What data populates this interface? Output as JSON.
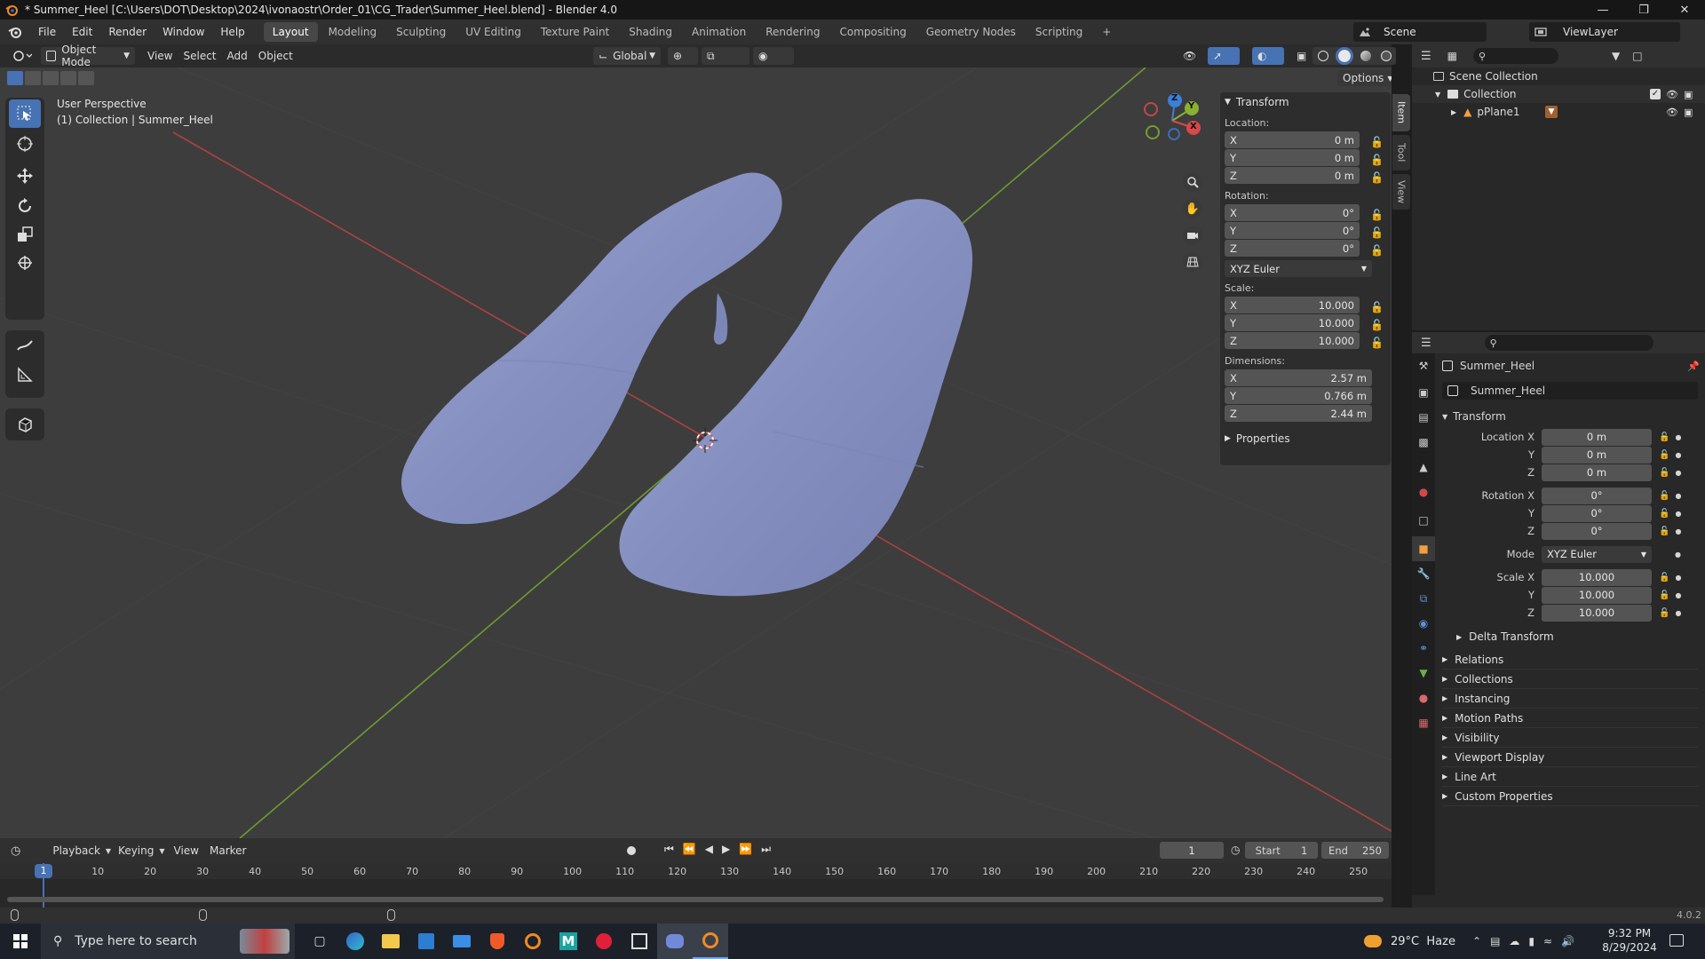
{
  "window": {
    "title": "* Summer_Heel [C:\\Users\\DOT\\Desktop\\2024\\ivonaostr\\Order_01\\CG_Trader\\Summer_Heel.blend] - Blender 4.0"
  },
  "menu": {
    "items": [
      "File",
      "Edit",
      "Render",
      "Window",
      "Help"
    ],
    "workspaces": [
      "Layout",
      "Modeling",
      "Sculpting",
      "UV Editing",
      "Texture Paint",
      "Shading",
      "Animation",
      "Rendering",
      "Compositing",
      "Geometry Nodes",
      "Scripting"
    ],
    "add_tab": "+",
    "scene": "Scene",
    "view_layer": "ViewLayer"
  },
  "viewport_header": {
    "mode": "Object Mode",
    "menus": [
      "View",
      "Select",
      "Add",
      "Object"
    ],
    "orientation": "Global",
    "options": "Options"
  },
  "viewport": {
    "perspective": "User Perspective",
    "collection_info": "(1) Collection | Summer_Heel",
    "gizmo_axes": [
      "Z",
      "Y",
      "X"
    ]
  },
  "npanel": {
    "tabs": [
      "Item",
      "Tool",
      "View"
    ],
    "transform_title": "Transform",
    "location_label": "Location:",
    "location": [
      {
        "axis": "X",
        "value": "0 m"
      },
      {
        "axis": "Y",
        "value": "0 m"
      },
      {
        "axis": "Z",
        "value": "0 m"
      }
    ],
    "rotation_label": "Rotation:",
    "rotation": [
      {
        "axis": "X",
        "value": "0°"
      },
      {
        "axis": "Y",
        "value": "0°"
      },
      {
        "axis": "Z",
        "value": "0°"
      }
    ],
    "rotation_mode": "XYZ Euler",
    "scale_label": "Scale:",
    "scale": [
      {
        "axis": "X",
        "value": "10.000"
      },
      {
        "axis": "Y",
        "value": "10.000"
      },
      {
        "axis": "Z",
        "value": "10.000"
      }
    ],
    "dimensions_label": "Dimensions:",
    "dimensions": [
      {
        "axis": "X",
        "value": "2.57 m"
      },
      {
        "axis": "Y",
        "value": "0.766 m"
      },
      {
        "axis": "Z",
        "value": "2.44 m"
      }
    ],
    "properties_title": "Properties"
  },
  "outliner": {
    "scene_collection": "Scene Collection",
    "collection": "Collection",
    "object": "pPlane1"
  },
  "properties": {
    "object_name": "Summer_Heel",
    "data_name": "Summer_Heel",
    "transform_title": "Transform",
    "location_label": "Location X",
    "location": [
      "0 m",
      "0 m",
      "0 m"
    ],
    "rotation_label": "Rotation X",
    "rotation": [
      "0°",
      "0°",
      "0°"
    ],
    "mode_label": "Mode",
    "mode": "XYZ Euler",
    "scale_label": "Scale X",
    "scale": [
      "10.000",
      "10.000",
      "10.000"
    ],
    "axis_y": "Y",
    "axis_z": "Z",
    "sections": [
      "Delta Transform",
      "Relations",
      "Collections",
      "Instancing",
      "Motion Paths",
      "Visibility",
      "Viewport Display",
      "Line Art",
      "Custom Properties"
    ]
  },
  "timeline": {
    "menus": [
      "Playback",
      "Keying",
      "View",
      "Marker"
    ],
    "current_frame": "1",
    "start_label": "Start",
    "start": "1",
    "end_label": "End",
    "end": "250",
    "ruler": [
      "1",
      "10",
      "20",
      "30",
      "40",
      "50",
      "60",
      "70",
      "80",
      "90",
      "100",
      "110",
      "120",
      "130",
      "140",
      "150",
      "160",
      "170",
      "180",
      "190",
      "200",
      "210",
      "220",
      "230",
      "240",
      "250"
    ]
  },
  "status": {
    "version": "4.0.2"
  },
  "taskbar": {
    "search_placeholder": "Type here to search",
    "weather": "29°C  Haze",
    "time": "9:32 PM",
    "date": "8/29/2024"
  },
  "colors": {
    "accent": "#4772b3",
    "viewport_bg": "#3d3d3d",
    "mesh": "#8a95c2",
    "axis_x": "#c04848",
    "axis_y": "#7aa035"
  }
}
